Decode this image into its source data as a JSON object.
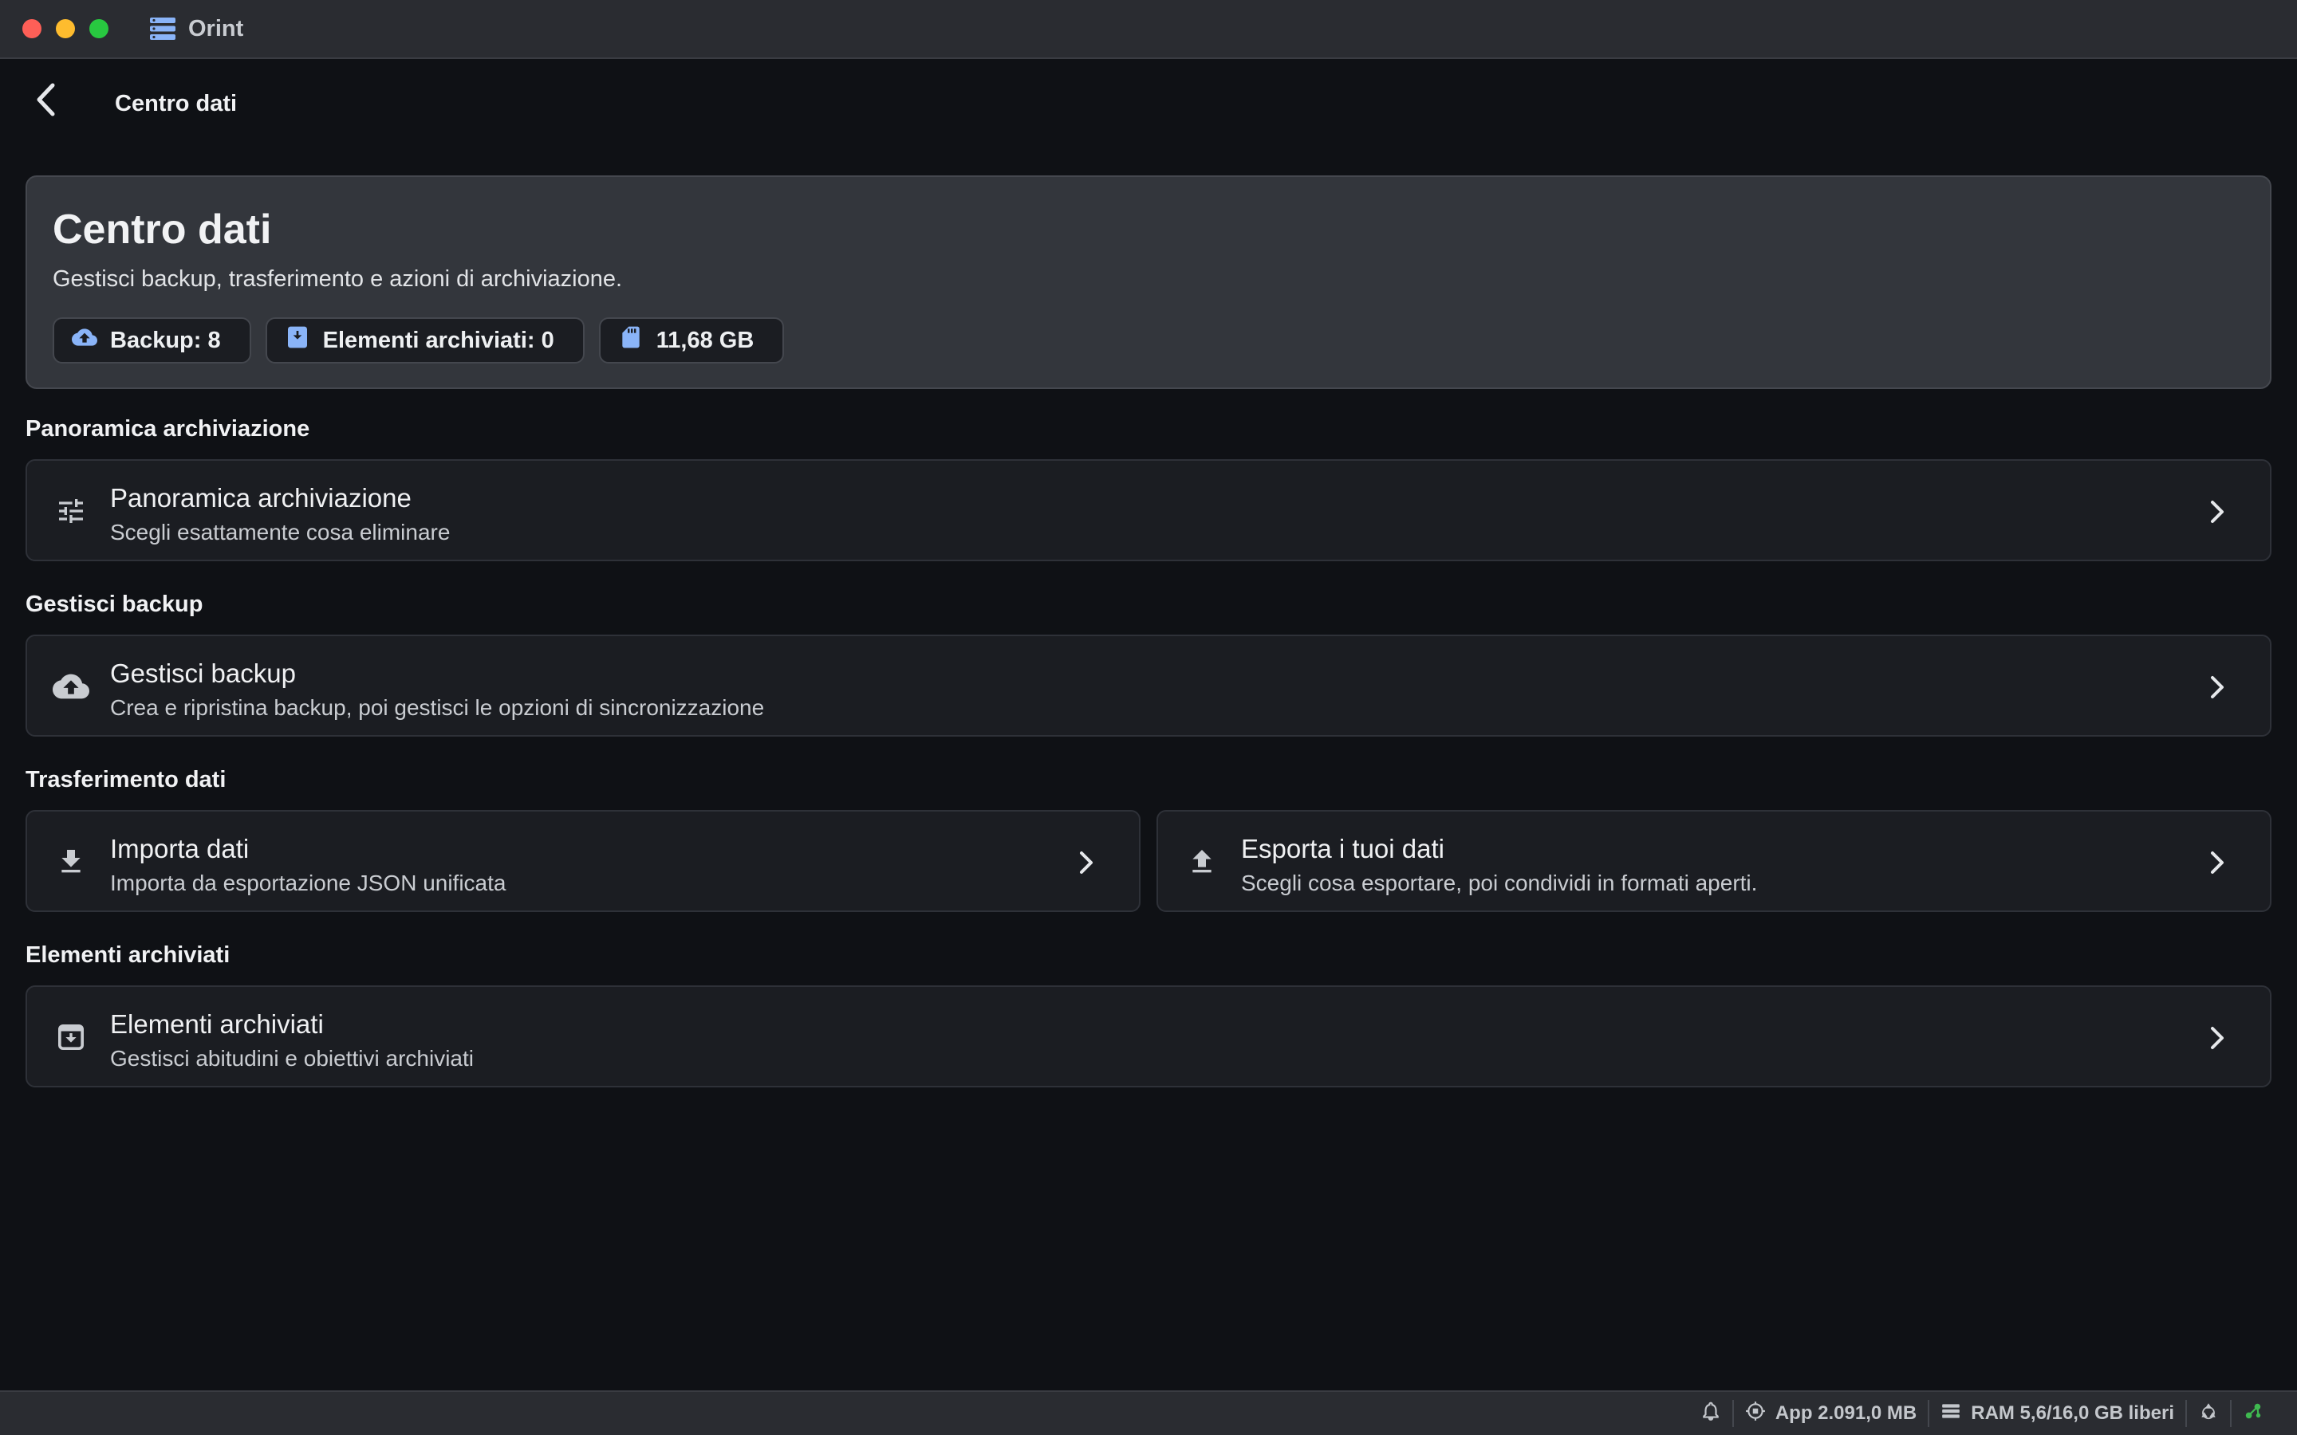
{
  "window": {
    "app_name": "Orint"
  },
  "header": {
    "title": "Centro dati"
  },
  "hero": {
    "title": "Centro dati",
    "subtitle": "Gestisci backup, trasferimento e azioni di archiviazione.",
    "chips": [
      {
        "icon": "cloud-upload-icon",
        "label": "Backup: 8"
      },
      {
        "icon": "archive-box-icon",
        "label": "Elementi archiviati: 0"
      },
      {
        "icon": "sd-card-icon",
        "label": "11,68 GB"
      }
    ]
  },
  "sections": {
    "storage": {
      "label": "Panoramica archiviazione",
      "title": "Panoramica archiviazione",
      "subtitle": "Scegli esattamente cosa eliminare",
      "icon": "tune-sliders-icon"
    },
    "backup": {
      "label": "Gestisci backup",
      "title": "Gestisci backup",
      "subtitle": "Crea e ripristina backup, poi gestisci le opzioni di sincronizzazione",
      "icon": "cloud-upload-icon"
    },
    "transfer": {
      "label": "Trasferimento dati",
      "import": {
        "title": "Importa dati",
        "subtitle": "Importa da esportazione JSON unificata",
        "icon": "download-icon"
      },
      "export": {
        "title": "Esporta i tuoi dati",
        "subtitle": "Scegli cosa esportare, poi condividi in formati aperti.",
        "icon": "upload-icon"
      }
    },
    "archived": {
      "label": "Elementi archiviati",
      "title": "Elementi archiviati",
      "subtitle": "Gestisci abitudini e obiettivi archiviati",
      "icon": "archive-box-icon"
    }
  },
  "statusbar": {
    "app_memory": "App 2.091,0 MB",
    "ram": "RAM 5,6/16,0 GB liberi"
  },
  "colors": {
    "background": "#0f1115",
    "card": "#1b1d22",
    "hero": "#33363c",
    "accent_blue": "#8ab4f8",
    "status_green": "#3fb950"
  }
}
